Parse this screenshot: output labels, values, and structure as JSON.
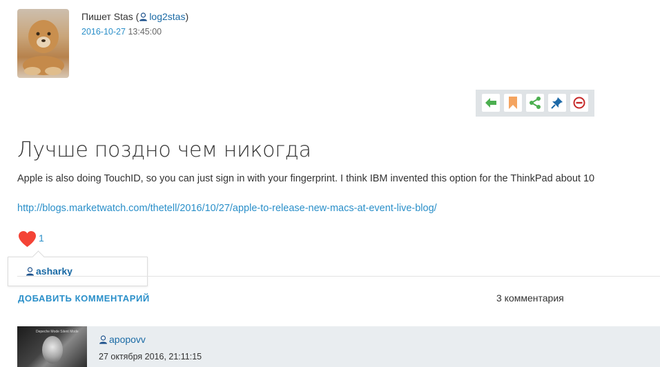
{
  "post": {
    "author_prefix": "Пишет Stas (",
    "author_username": "log2stas",
    "author_suffix": ")",
    "date": "2016-10-27",
    "time": "13:45:00",
    "title": "Лучше поздно чем никогда",
    "body": "Apple is also doing TouchID, so you can just sign in with your fingerprint. I think IBM invented this option for the ThinkPad about 10",
    "link": "http://blogs.marketwatch.com/thetell/2016/10/27/apple-to-release-new-macs-at-event-live-blog/"
  },
  "toolbar": {
    "buttons": [
      {
        "icon": "reply-arrow-icon",
        "color": "#4caf50"
      },
      {
        "icon": "bookmark-icon",
        "color": "#f4a460"
      },
      {
        "icon": "share-icon",
        "color": "#4caf50"
      },
      {
        "icon": "pin-icon",
        "color": "#1e6aa8"
      },
      {
        "icon": "block-icon",
        "color": "#c62828"
      }
    ]
  },
  "likes": {
    "count": "1",
    "likers": [
      "asharky"
    ]
  },
  "comments_bar": {
    "add_label": "ДОБАВИТЬ КОММЕНТАРИЙ",
    "count_label": "3 комментария"
  },
  "comment": {
    "username": "apopovv",
    "date": "27 октября 2016, 21:11:15",
    "avatar_text": "Depeche Mode Silent Mode"
  },
  "colors": {
    "link": "#2a8fc9",
    "heart": "#f44336",
    "toolbar_bg": "#dfe3e6",
    "comment_bg": "#e9edf0"
  }
}
